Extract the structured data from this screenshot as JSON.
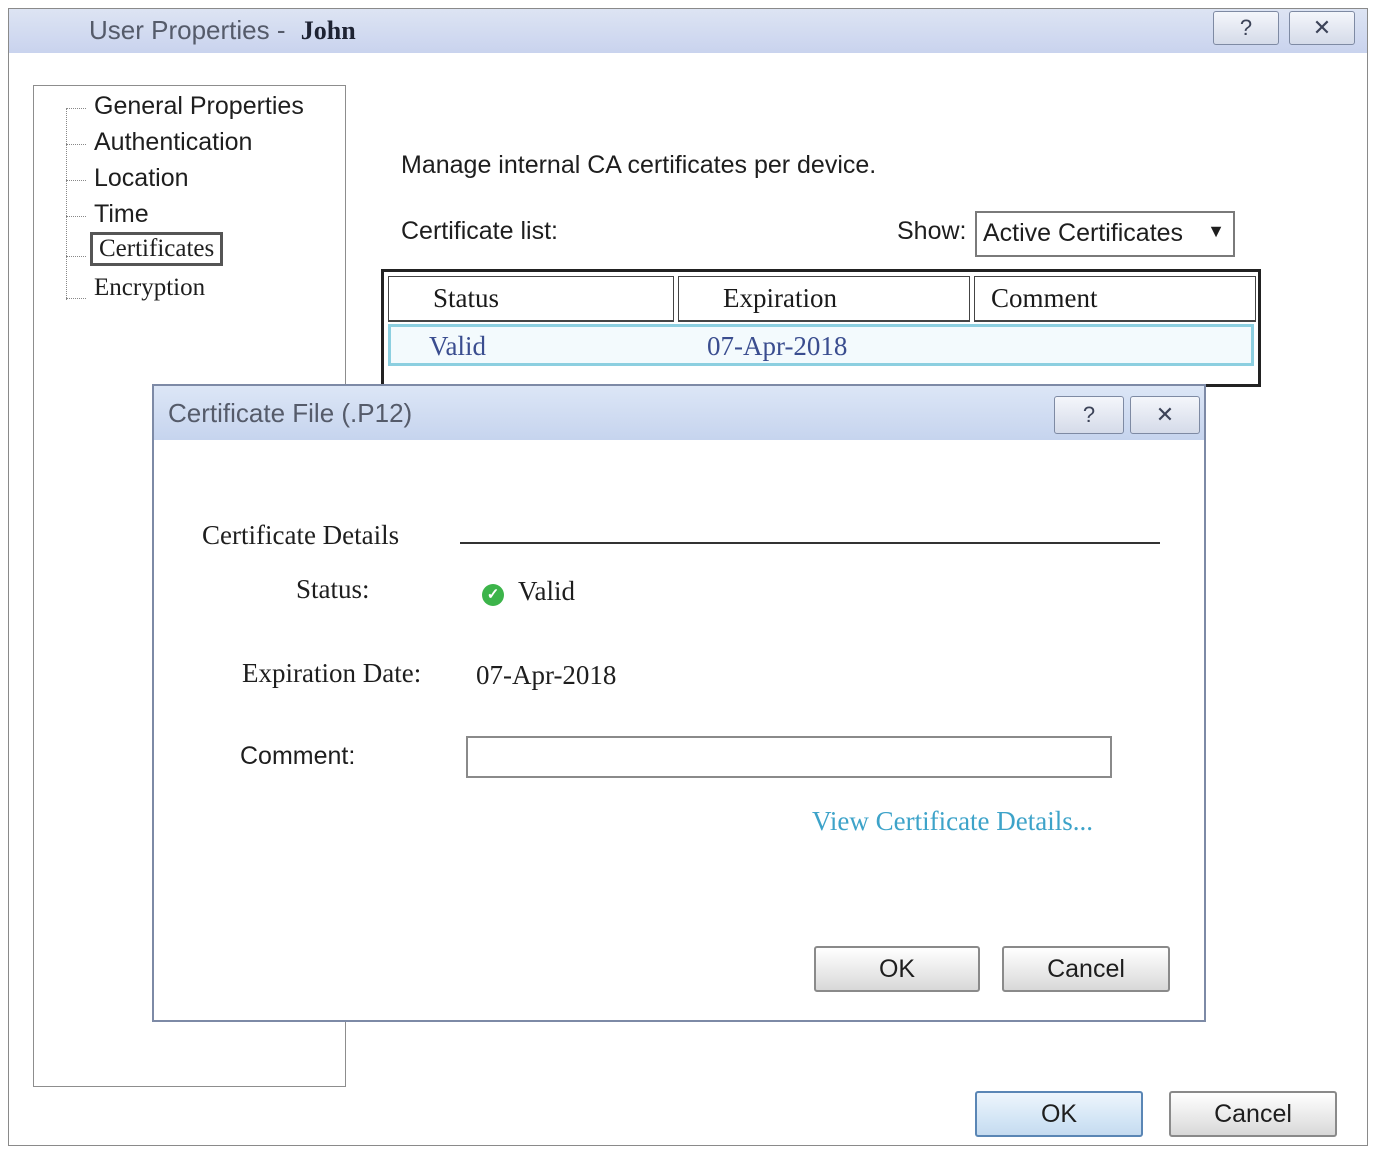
{
  "window": {
    "title_prefix": "User Properties - ",
    "title_user": "John",
    "help_label": "?",
    "close_label": "✕"
  },
  "nav": {
    "items": [
      {
        "label": "General Properties"
      },
      {
        "label": "Authentication"
      },
      {
        "label": "Location"
      },
      {
        "label": "Time"
      },
      {
        "label": "Certificates"
      },
      {
        "label": "Encryption"
      }
    ],
    "selected": "Certificates"
  },
  "content": {
    "intro": "Manage internal CA certificates per device.",
    "cert_list_label": "Certificate list:",
    "show_label": "Show:",
    "show_value": "Active Certificates",
    "table": {
      "columns": [
        "Status",
        "Expiration",
        "Comment"
      ],
      "rows": [
        {
          "status": "Valid",
          "expiration": "07-Apr-2018",
          "comment": ""
        }
      ]
    }
  },
  "dialog": {
    "title": "Certificate File (.P12)",
    "help_label": "?",
    "close_label": "✕",
    "section_title": "Certificate Details",
    "status_label": "Status:",
    "status_value": "Valid",
    "expiration_label": "Expiration Date:",
    "expiration_value": "07-Apr-2018",
    "comment_label": "Comment:",
    "comment_value": "",
    "view_link": "View Certificate Details...",
    "ok_label": "OK",
    "cancel_label": "Cancel"
  },
  "footer": {
    "ok_label": "OK",
    "cancel_label": "Cancel"
  },
  "colors": {
    "title_bar": "#c9d3ee",
    "selected_row_border": "#8ccfe0",
    "link": "#3da3c9",
    "valid_icon": "#3cb44a",
    "cell_text": "#3a4d8f"
  },
  "icons": {
    "help": "question-mark-icon",
    "close": "close-icon",
    "dropdown": "chevron-down-icon",
    "status": "check-circle-icon"
  }
}
